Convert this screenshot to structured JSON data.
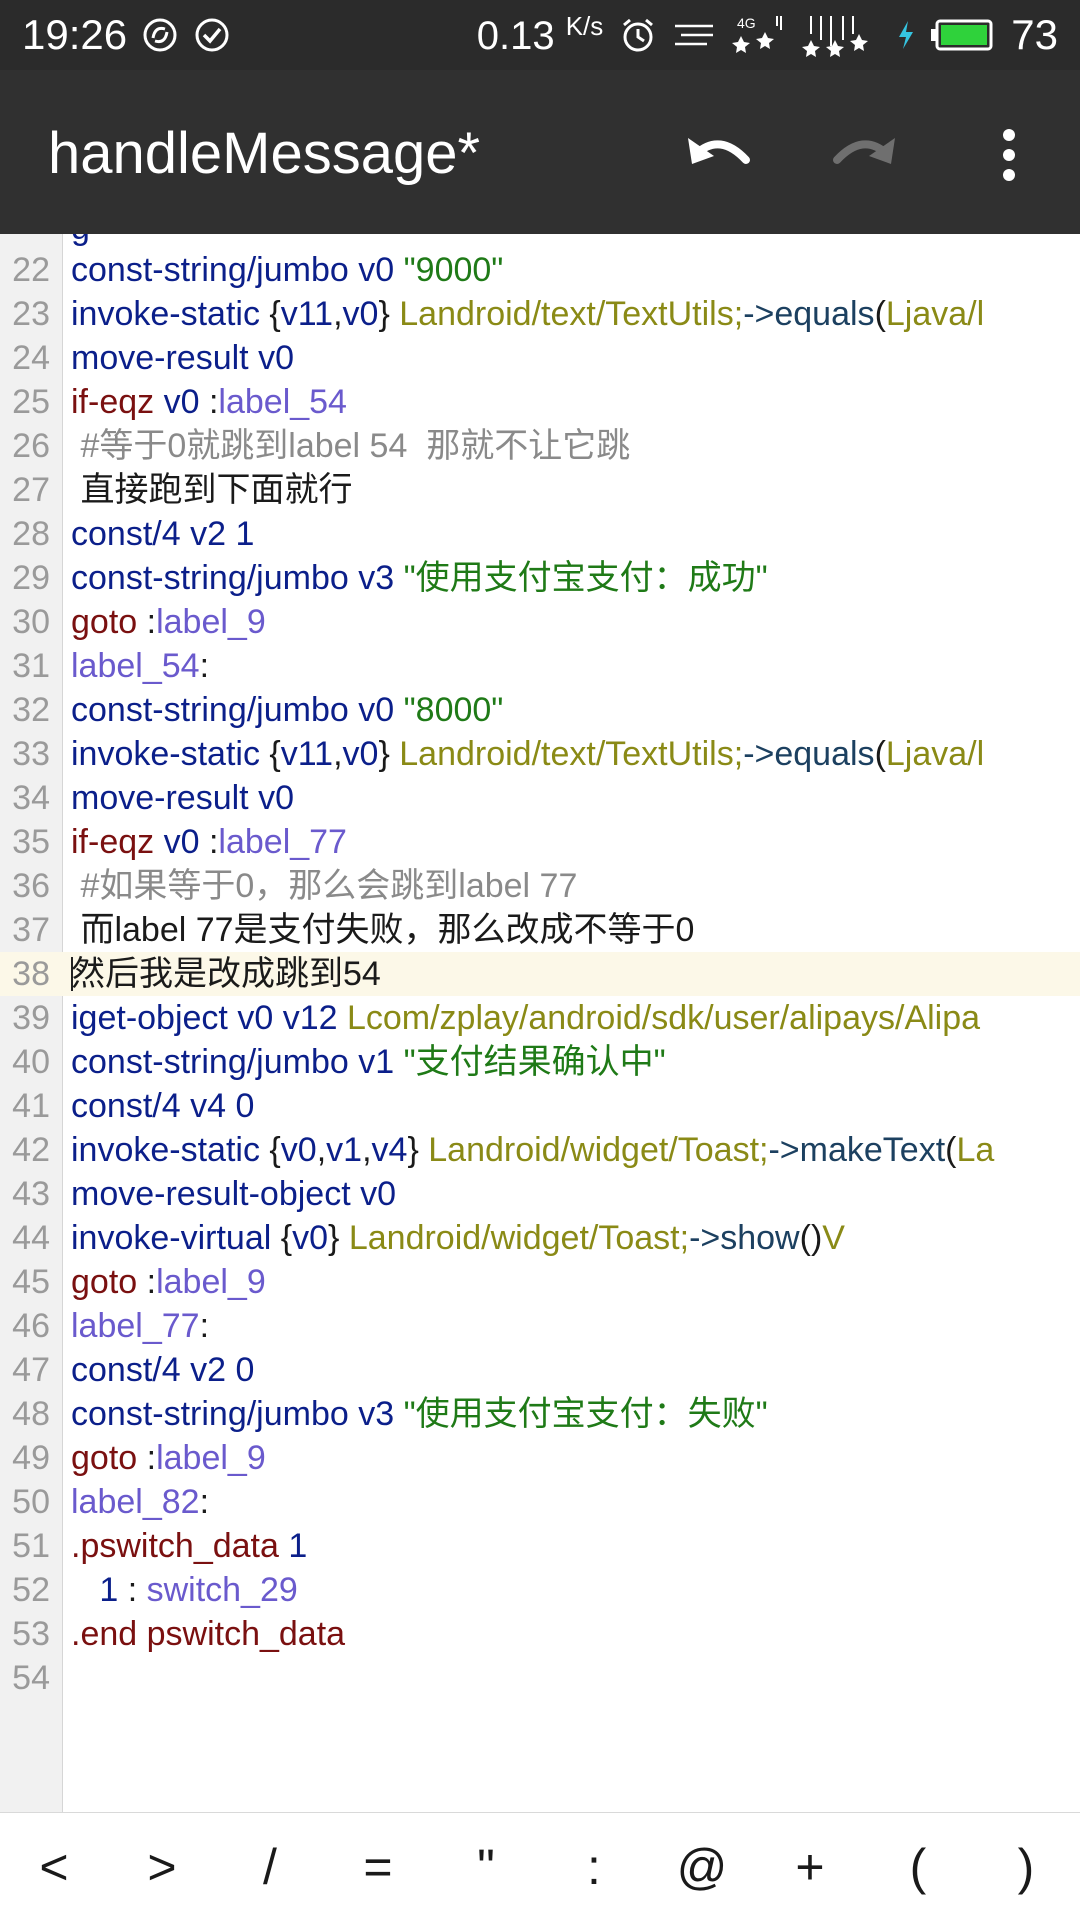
{
  "status_bar": {
    "time": "19:26",
    "speed": "0.13",
    "speed_unit": "K/s",
    "network": "4G",
    "battery": "73",
    "icons": [
      "sync-icon",
      "check-circle-icon",
      "alarm-icon",
      "signal-icon",
      "charging-icon",
      "battery-icon"
    ]
  },
  "toolbar": {
    "title": "handleMessage*",
    "undo_icon": "undo-icon",
    "redo_icon": "redo-icon",
    "menu_icon": "more-vert-icon"
  },
  "editor": {
    "current_line": "38",
    "lines": [
      {
        "n": "22",
        "tokens": [
          {
            "t": "const-string/jumbo ",
            "c": "kw"
          },
          {
            "t": "v0 ",
            "c": "kw"
          },
          {
            "t": "\"9000\"",
            "c": "str"
          }
        ]
      },
      {
        "n": "23",
        "tokens": [
          {
            "t": "invoke-static ",
            "c": "kw"
          },
          {
            "t": "{",
            "c": "plain"
          },
          {
            "t": "v11",
            "c": "kw"
          },
          {
            "t": ",",
            "c": "plain"
          },
          {
            "t": "v0",
            "c": "kw"
          },
          {
            "t": "} ",
            "c": "plain"
          },
          {
            "t": "Landroid/text/TextUtils;",
            "c": "cls"
          },
          {
            "t": "->equals",
            "c": "meth"
          },
          {
            "t": "(",
            "c": "plain"
          },
          {
            "t": "Ljava/l",
            "c": "cls"
          }
        ]
      },
      {
        "n": "24",
        "tokens": [
          {
            "t": "move-result ",
            "c": "kw"
          },
          {
            "t": "v0",
            "c": "kw"
          }
        ]
      },
      {
        "n": "25",
        "tokens": [
          {
            "t": "if-eqz ",
            "c": "jmp"
          },
          {
            "t": "v0 ",
            "c": "kw"
          },
          {
            "t": ":",
            "c": "plain"
          },
          {
            "t": "label_54",
            "c": "lbl"
          }
        ]
      },
      {
        "n": "26",
        "tokens": [
          {
            "t": " #等于0就跳到label 54  那就不让它跳",
            "c": "cmt"
          }
        ]
      },
      {
        "n": "27",
        "tokens": [
          {
            "t": " 直接跑到下面就行",
            "c": "plain"
          }
        ]
      },
      {
        "n": "28",
        "tokens": [
          {
            "t": "const/4 ",
            "c": "kw"
          },
          {
            "t": "v2 ",
            "c": "kw"
          },
          {
            "t": "1",
            "c": "num"
          }
        ]
      },
      {
        "n": "29",
        "tokens": [
          {
            "t": "const-string/jumbo ",
            "c": "kw"
          },
          {
            "t": "v3 ",
            "c": "kw"
          },
          {
            "t": "\"使用支付宝支付：成功\"",
            "c": "str"
          }
        ]
      },
      {
        "n": "30",
        "tokens": [
          {
            "t": "goto ",
            "c": "jmp"
          },
          {
            "t": ":",
            "c": "plain"
          },
          {
            "t": "label_9",
            "c": "lbl"
          }
        ]
      },
      {
        "n": "31",
        "tokens": [
          {
            "t": "label_54",
            "c": "lbl"
          },
          {
            "t": ":",
            "c": "plain"
          }
        ]
      },
      {
        "n": "32",
        "tokens": [
          {
            "t": "const-string/jumbo ",
            "c": "kw"
          },
          {
            "t": "v0 ",
            "c": "kw"
          },
          {
            "t": "\"8000\"",
            "c": "str"
          }
        ]
      },
      {
        "n": "33",
        "tokens": [
          {
            "t": "invoke-static ",
            "c": "kw"
          },
          {
            "t": "{",
            "c": "plain"
          },
          {
            "t": "v11",
            "c": "kw"
          },
          {
            "t": ",",
            "c": "plain"
          },
          {
            "t": "v0",
            "c": "kw"
          },
          {
            "t": "} ",
            "c": "plain"
          },
          {
            "t": "Landroid/text/TextUtils;",
            "c": "cls"
          },
          {
            "t": "->equals",
            "c": "meth"
          },
          {
            "t": "(",
            "c": "plain"
          },
          {
            "t": "Ljava/l",
            "c": "cls"
          }
        ]
      },
      {
        "n": "34",
        "tokens": [
          {
            "t": "move-result ",
            "c": "kw"
          },
          {
            "t": "v0",
            "c": "kw"
          }
        ]
      },
      {
        "n": "35",
        "tokens": [
          {
            "t": "if-eqz ",
            "c": "jmp"
          },
          {
            "t": "v0 ",
            "c": "kw"
          },
          {
            "t": ":",
            "c": "plain"
          },
          {
            "t": "label_77",
            "c": "lbl"
          }
        ]
      },
      {
        "n": "36",
        "tokens": [
          {
            "t": " #如果等于0，那么会跳到label 77",
            "c": "cmt"
          }
        ]
      },
      {
        "n": "37",
        "tokens": [
          {
            "t": " 而label 77是支付失败，那么改成不等于0",
            "c": "plain"
          }
        ]
      },
      {
        "n": "38",
        "tokens": [
          {
            "t": "然后我是改成跳到54",
            "c": "plain"
          }
        ]
      },
      {
        "n": "39",
        "tokens": [
          {
            "t": "iget-object ",
            "c": "kw"
          },
          {
            "t": "v0 ",
            "c": "kw"
          },
          {
            "t": "v12 ",
            "c": "kw"
          },
          {
            "t": "Lcom/zplay/android/sdk/user/alipays/Alipa",
            "c": "cls"
          }
        ]
      },
      {
        "n": "40",
        "tokens": [
          {
            "t": "const-string/jumbo ",
            "c": "kw"
          },
          {
            "t": "v1 ",
            "c": "kw"
          },
          {
            "t": "\"支付结果确认中\"",
            "c": "str"
          }
        ]
      },
      {
        "n": "41",
        "tokens": [
          {
            "t": "const/4 ",
            "c": "kw"
          },
          {
            "t": "v4 ",
            "c": "kw"
          },
          {
            "t": "0",
            "c": "num"
          }
        ]
      },
      {
        "n": "42",
        "tokens": [
          {
            "t": "invoke-static ",
            "c": "kw"
          },
          {
            "t": "{",
            "c": "plain"
          },
          {
            "t": "v0",
            "c": "kw"
          },
          {
            "t": ",",
            "c": "plain"
          },
          {
            "t": "v1",
            "c": "kw"
          },
          {
            "t": ",",
            "c": "plain"
          },
          {
            "t": "v4",
            "c": "kw"
          },
          {
            "t": "} ",
            "c": "plain"
          },
          {
            "t": "Landroid/widget/Toast;",
            "c": "cls"
          },
          {
            "t": "->makeText",
            "c": "meth"
          },
          {
            "t": "(",
            "c": "plain"
          },
          {
            "t": "La",
            "c": "cls"
          }
        ]
      },
      {
        "n": "43",
        "tokens": [
          {
            "t": "move-result-object ",
            "c": "kw"
          },
          {
            "t": "v0",
            "c": "kw"
          }
        ]
      },
      {
        "n": "44",
        "tokens": [
          {
            "t": "invoke-virtual ",
            "c": "kw"
          },
          {
            "t": "{",
            "c": "plain"
          },
          {
            "t": "v0",
            "c": "kw"
          },
          {
            "t": "} ",
            "c": "plain"
          },
          {
            "t": "Landroid/widget/Toast;",
            "c": "cls"
          },
          {
            "t": "->show",
            "c": "meth"
          },
          {
            "t": "()",
            "c": "plain"
          },
          {
            "t": "V",
            "c": "cls"
          }
        ]
      },
      {
        "n": "45",
        "tokens": [
          {
            "t": "goto ",
            "c": "jmp"
          },
          {
            "t": ":",
            "c": "plain"
          },
          {
            "t": "label_9",
            "c": "lbl"
          }
        ]
      },
      {
        "n": "46",
        "tokens": [
          {
            "t": "label_77",
            "c": "lbl"
          },
          {
            "t": ":",
            "c": "plain"
          }
        ]
      },
      {
        "n": "47",
        "tokens": [
          {
            "t": "const/4 ",
            "c": "kw"
          },
          {
            "t": "v2 ",
            "c": "kw"
          },
          {
            "t": "0",
            "c": "num"
          }
        ]
      },
      {
        "n": "48",
        "tokens": [
          {
            "t": "const-string/jumbo ",
            "c": "kw"
          },
          {
            "t": "v3 ",
            "c": "kw"
          },
          {
            "t": "\"使用支付宝支付：失败\"",
            "c": "str"
          }
        ]
      },
      {
        "n": "49",
        "tokens": [
          {
            "t": "goto ",
            "c": "jmp"
          },
          {
            "t": ":",
            "c": "plain"
          },
          {
            "t": "label_9",
            "c": "lbl"
          }
        ]
      },
      {
        "n": "50",
        "tokens": [
          {
            "t": "label_82",
            "c": "lbl"
          },
          {
            "t": ":",
            "c": "plain"
          }
        ]
      },
      {
        "n": "51",
        "tokens": [
          {
            "t": ".pswitch_data ",
            "c": "dir"
          },
          {
            "t": "1",
            "c": "num"
          }
        ]
      },
      {
        "n": "52",
        "tokens": [
          {
            "t": "   1",
            "c": "num"
          },
          {
            "t": " : ",
            "c": "plain"
          },
          {
            "t": "switch_29",
            "c": "lbl"
          }
        ]
      },
      {
        "n": "53",
        "tokens": [
          {
            "t": ".end pswitch_data",
            "c": "dir"
          }
        ]
      },
      {
        "n": "54",
        "tokens": []
      }
    ]
  },
  "symbol_keys": [
    "<",
    ">",
    "/",
    "=",
    "\"",
    ":",
    "@",
    "+",
    "(",
    ")"
  ],
  "colors": {
    "status_bar": "#2b2b2b",
    "app_bar": "#303030",
    "keyword": "#0b1f8a",
    "string": "#1f7a17",
    "label": "#6a5acd",
    "class": "#8a8a16",
    "comment": "#8a8a8a",
    "current_line": "#fcf8e8"
  }
}
